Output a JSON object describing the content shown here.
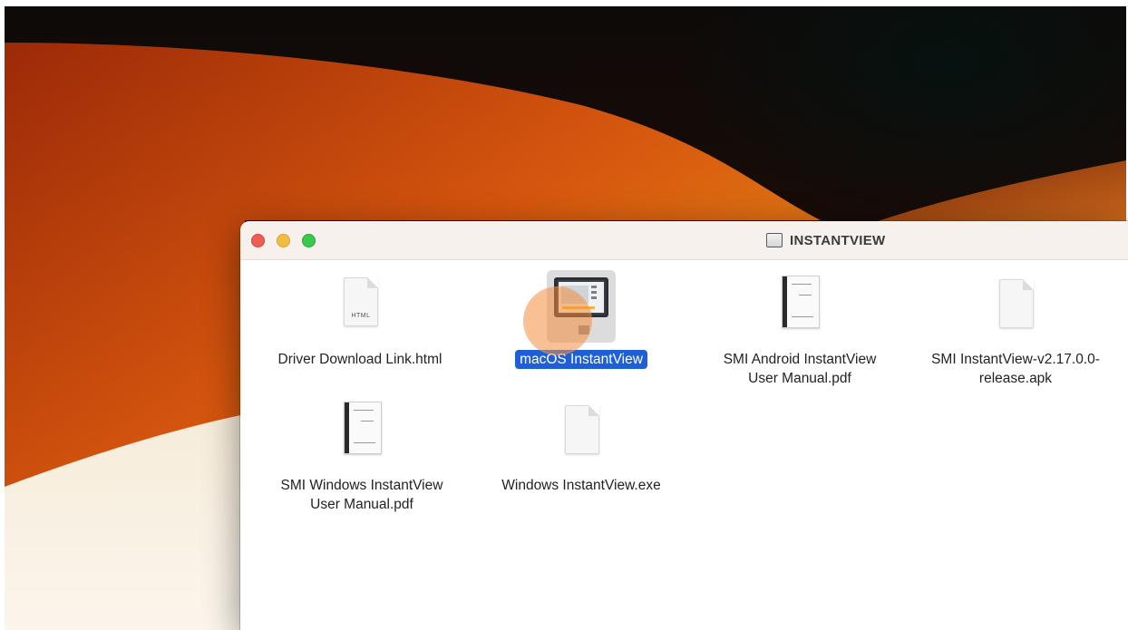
{
  "window": {
    "title": "INSTANTVIEW",
    "controls": [
      "close",
      "minimize",
      "zoom"
    ]
  },
  "files": [
    {
      "name": "Driver Download Link.html",
      "kind": "html",
      "icon": "html-document-icon",
      "badge": "HTML",
      "selected": false
    },
    {
      "name": "macOS InstantView",
      "kind": "app",
      "icon": "application-icon",
      "selected": true
    },
    {
      "name": "SMI Android InstantView User Manual.pdf",
      "kind": "pdf",
      "icon": "pdf-document-icon",
      "selected": false
    },
    {
      "name": "SMI InstantView-v2.17.0.0-release.apk",
      "kind": "apk",
      "icon": "generic-document-icon",
      "selected": false
    },
    {
      "name": "SMI Windows InstantView User Manual.pdf",
      "kind": "pdf",
      "icon": "pdf-document-icon",
      "selected": false
    },
    {
      "name": "Windows InstantView.exe",
      "kind": "exe",
      "icon": "generic-document-icon",
      "selected": false
    }
  ],
  "colors": {
    "selection": "#1f5fd6",
    "close": "#ee5c54",
    "minimize": "#f5bd3d",
    "zoom": "#39c94d",
    "click_indicator": "#f48c3c"
  }
}
